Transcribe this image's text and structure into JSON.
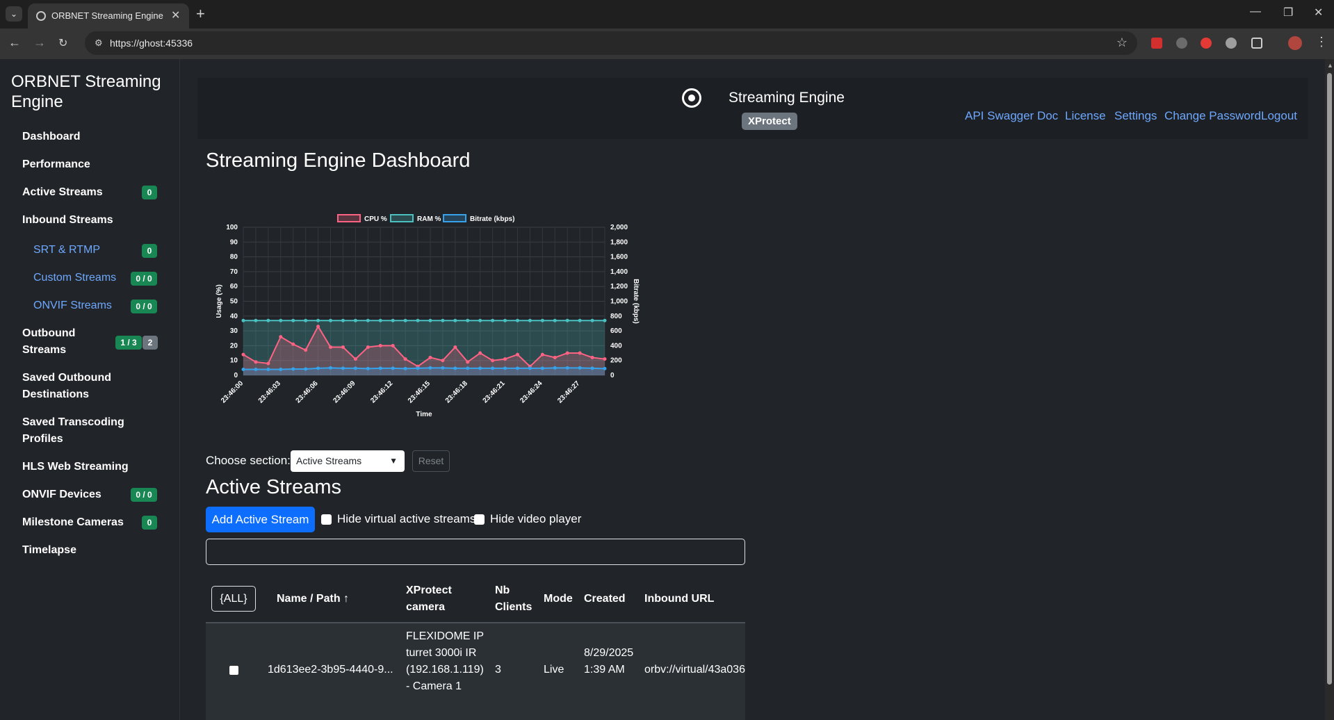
{
  "browser": {
    "tab_title": "ORBNET Streaming Engine",
    "url": "https://ghost:45336"
  },
  "sidebar": {
    "brand": "ORBNET Streaming Engine",
    "items": [
      {
        "label": "Dashboard"
      },
      {
        "label": "Performance"
      },
      {
        "label": "Active Streams",
        "badge": "0"
      },
      {
        "label": "Inbound Streams"
      },
      {
        "label": "SRT & RTMP",
        "badge": "0"
      },
      {
        "label": "Custom Streams",
        "badge": "0 / 0"
      },
      {
        "label": "ONVIF Streams",
        "badge": "0 / 0"
      },
      {
        "label": "Outbound Streams",
        "badge": "1 / 3",
        "badge2": "2"
      },
      {
        "label": "Saved Outbound Destinations"
      },
      {
        "label": "Saved Transcoding Profiles"
      },
      {
        "label": "HLS Web Streaming"
      },
      {
        "label": "ONVIF Devices",
        "badge": "0 / 0"
      },
      {
        "label": "Milestone Cameras",
        "badge": "0"
      },
      {
        "label": "Timelapse"
      }
    ]
  },
  "header": {
    "title": "Streaming Engine",
    "badge": "XProtect",
    "links": [
      "API Swagger Doc",
      "License",
      "Settings",
      "Change Password",
      "Logout"
    ]
  },
  "page": {
    "title": "Streaming Engine Dashboard",
    "choose_label": "Choose section:",
    "select_value": "Active Streams",
    "reset_label": "Reset",
    "section_title": "Active Streams",
    "add_button": "Add Active Stream",
    "hide_virtual": "Hide virtual active streams",
    "hide_player": "Hide video player"
  },
  "table": {
    "all_button": "{ALL}",
    "headers": [
      "Name / Path ↑",
      "XProtect camera",
      "Nb Clients",
      "Mode",
      "Created",
      "Inbound URL"
    ],
    "rows": [
      {
        "name": "1d613ee2-3b95-4440-9...",
        "camera": "FLEXIDOME IP turret 3000i IR (192.168.1.119) - Camera 1",
        "clients": "3",
        "mode": "Live",
        "created": "8/29/2025 1:39 AM",
        "url": "orbv://virtual/43a036"
      }
    ]
  },
  "colors": {
    "cpu": "#ff6384",
    "ram": "#4bc0c0",
    "bitrate": "#36a2eb",
    "accent": "#0d6efd",
    "link": "#6ea8fe"
  },
  "chart_data": {
    "type": "line",
    "x": [
      "23:46:00",
      "23:46:01",
      "23:46:02",
      "23:46:03",
      "23:46:04",
      "23:46:05",
      "23:46:06",
      "23:46:07",
      "23:46:08",
      "23:46:09",
      "23:46:10",
      "23:46:11",
      "23:46:12",
      "23:46:13",
      "23:46:14",
      "23:46:15",
      "23:46:16",
      "23:46:17",
      "23:46:18",
      "23:46:19",
      "23:46:20",
      "23:46:21",
      "23:46:22",
      "23:46:23",
      "23:46:24",
      "23:46:25",
      "23:46:26",
      "23:46:27",
      "23:46:28",
      "23:46:29"
    ],
    "xticks": [
      "23:46:00",
      "23:46:03",
      "23:46:06",
      "23:46:09",
      "23:46:12",
      "23:46:15",
      "23:46:18",
      "23:46:21",
      "23:46:24",
      "23:46:27"
    ],
    "series": [
      {
        "name": "CPU %",
        "axis": "left",
        "values": [
          14,
          9,
          8,
          26,
          21,
          17,
          33,
          19,
          19,
          11,
          19,
          20,
          20,
          11,
          6,
          12,
          10,
          19,
          9,
          15,
          10,
          11,
          14,
          6,
          14,
          12,
          15,
          15,
          12,
          11
        ]
      },
      {
        "name": "RAM %",
        "axis": "left",
        "values": [
          37,
          37,
          37,
          37,
          37,
          37,
          37,
          37,
          37,
          37,
          37,
          37,
          37,
          37,
          37,
          37,
          37,
          37,
          37,
          37,
          37,
          37,
          37,
          37,
          37,
          37,
          37,
          37,
          37,
          37
        ]
      },
      {
        "name": "Bitrate (kbps)",
        "axis": "right",
        "values": [
          80,
          80,
          80,
          80,
          85,
          85,
          95,
          100,
          95,
          95,
          90,
          95,
          95,
          90,
          95,
          100,
          100,
          95,
          95,
          95,
          95,
          95,
          95,
          95,
          95,
          100,
          100,
          100,
          95,
          90
        ]
      }
    ],
    "ylabel": "Usage (%)",
    "y2label": "Bitrate (kbps)",
    "xlabel": "Time",
    "ylim": [
      0,
      100
    ],
    "y2lim": [
      0,
      2000
    ],
    "yticks": [
      "0",
      "10",
      "20",
      "30",
      "40",
      "50",
      "60",
      "70",
      "80",
      "90",
      "100"
    ],
    "y2ticks": [
      "0",
      "200",
      "400",
      "600",
      "800",
      "1,000",
      "1,200",
      "1,400",
      "1,600",
      "1,800",
      "2,000"
    ],
    "legend": "top",
    "grid": true
  }
}
